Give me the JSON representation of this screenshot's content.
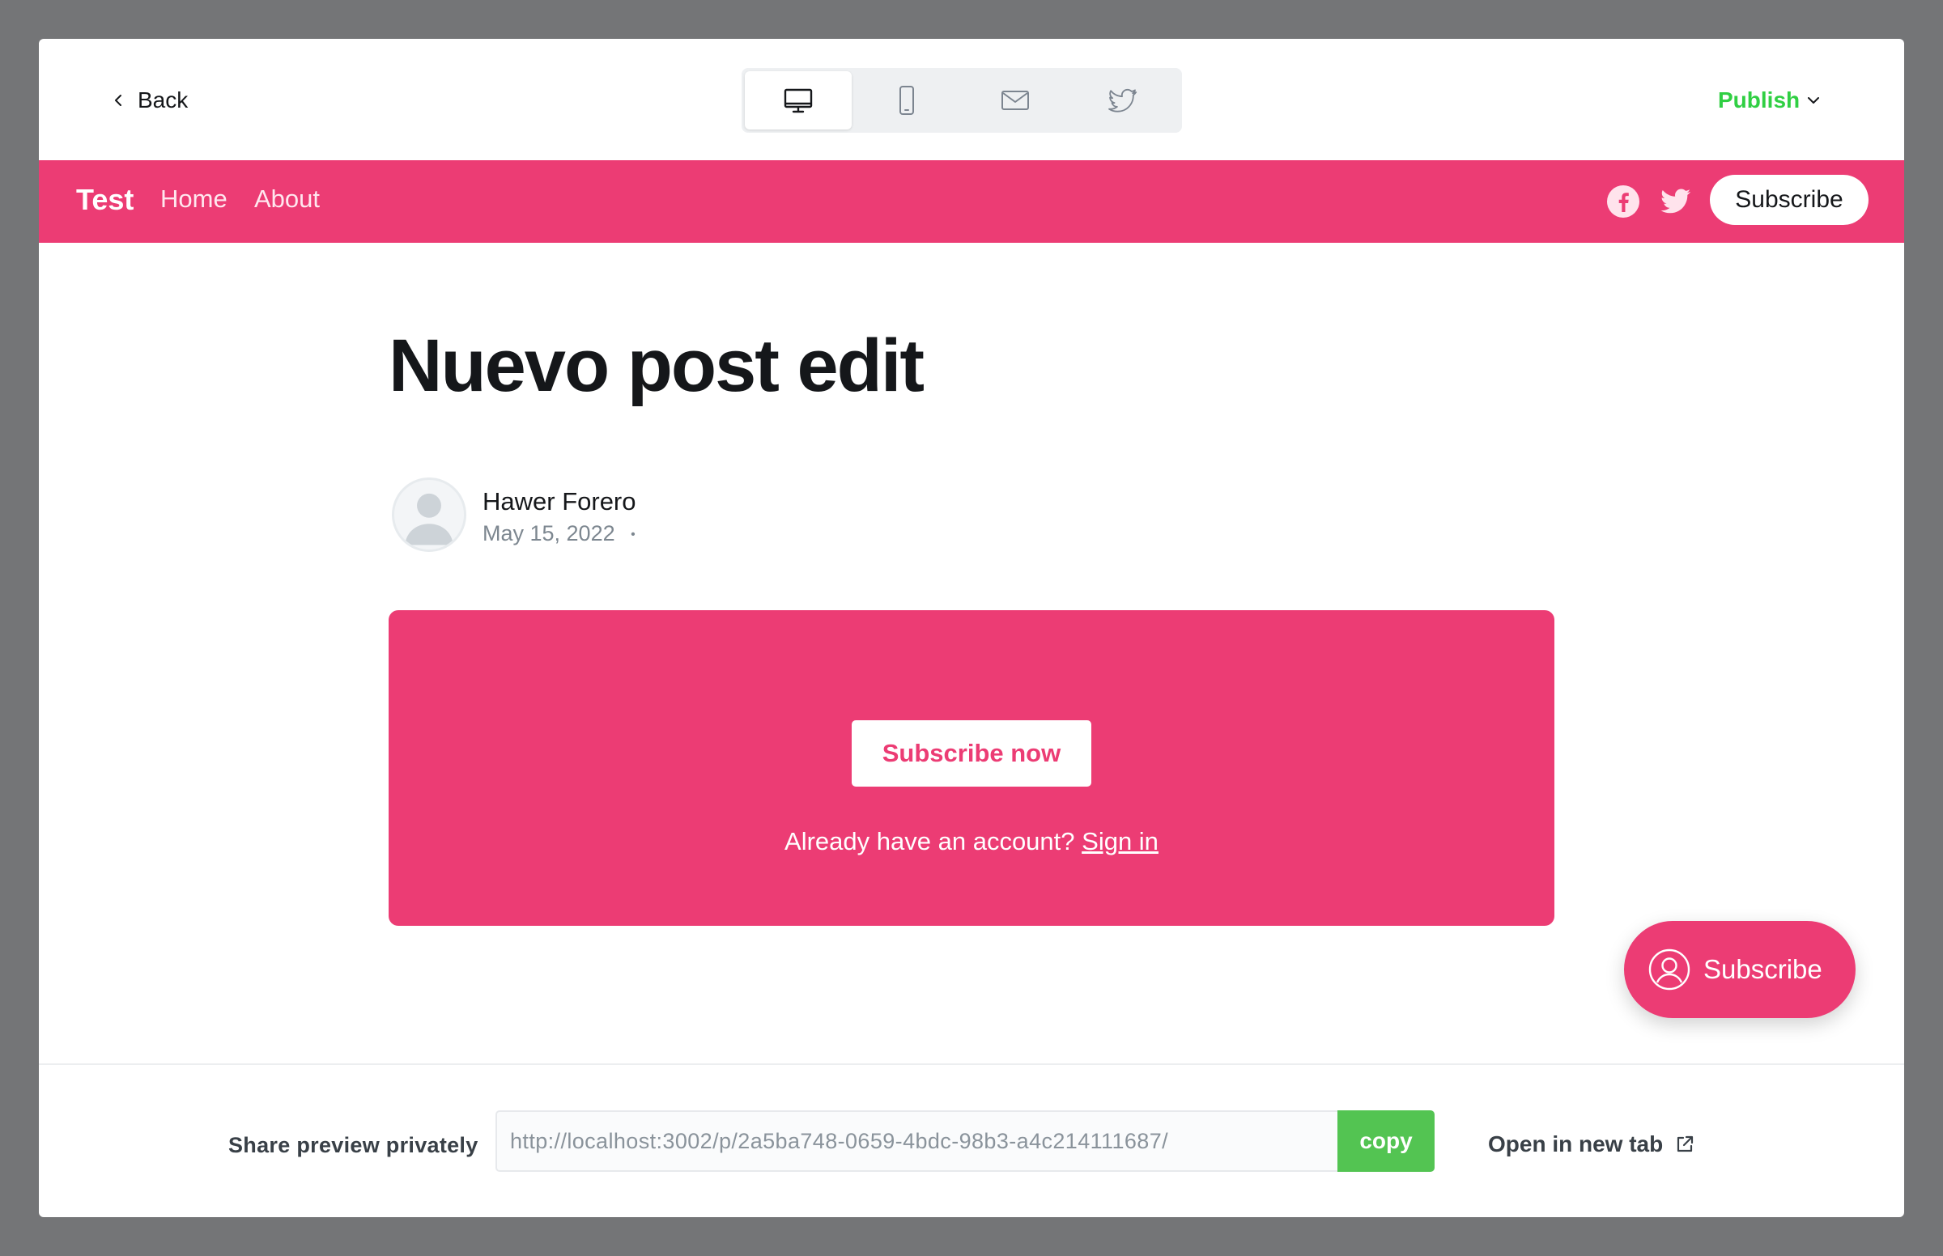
{
  "toolbar": {
    "back_label": "Back",
    "publish_label": "Publish",
    "devices": [
      {
        "name": "desktop",
        "active": true
      },
      {
        "name": "mobile",
        "active": false
      },
      {
        "name": "email",
        "active": false
      },
      {
        "name": "twitter",
        "active": false
      }
    ]
  },
  "site": {
    "brand": "Test",
    "nav": [
      "Home",
      "About"
    ],
    "subscribe_label": "Subscribe",
    "accent_color": "#ec3c74"
  },
  "post": {
    "title": "Nuevo post edit",
    "author": "Hawer Forero",
    "date": "May 15, 2022",
    "date_separator": "•"
  },
  "cta": {
    "button_label": "Subscribe now",
    "signin_prompt": "Already have an account?",
    "signin_link": "Sign in"
  },
  "portal": {
    "label": "Subscribe"
  },
  "footer": {
    "share_label": "Share preview privately",
    "share_url": "http://localhost:3002/p/2a5ba748-0659-4bdc-98b3-a4c214111687/",
    "copy_label": "copy",
    "open_tab_label": "Open in new tab",
    "copy_color": "#53c452"
  }
}
